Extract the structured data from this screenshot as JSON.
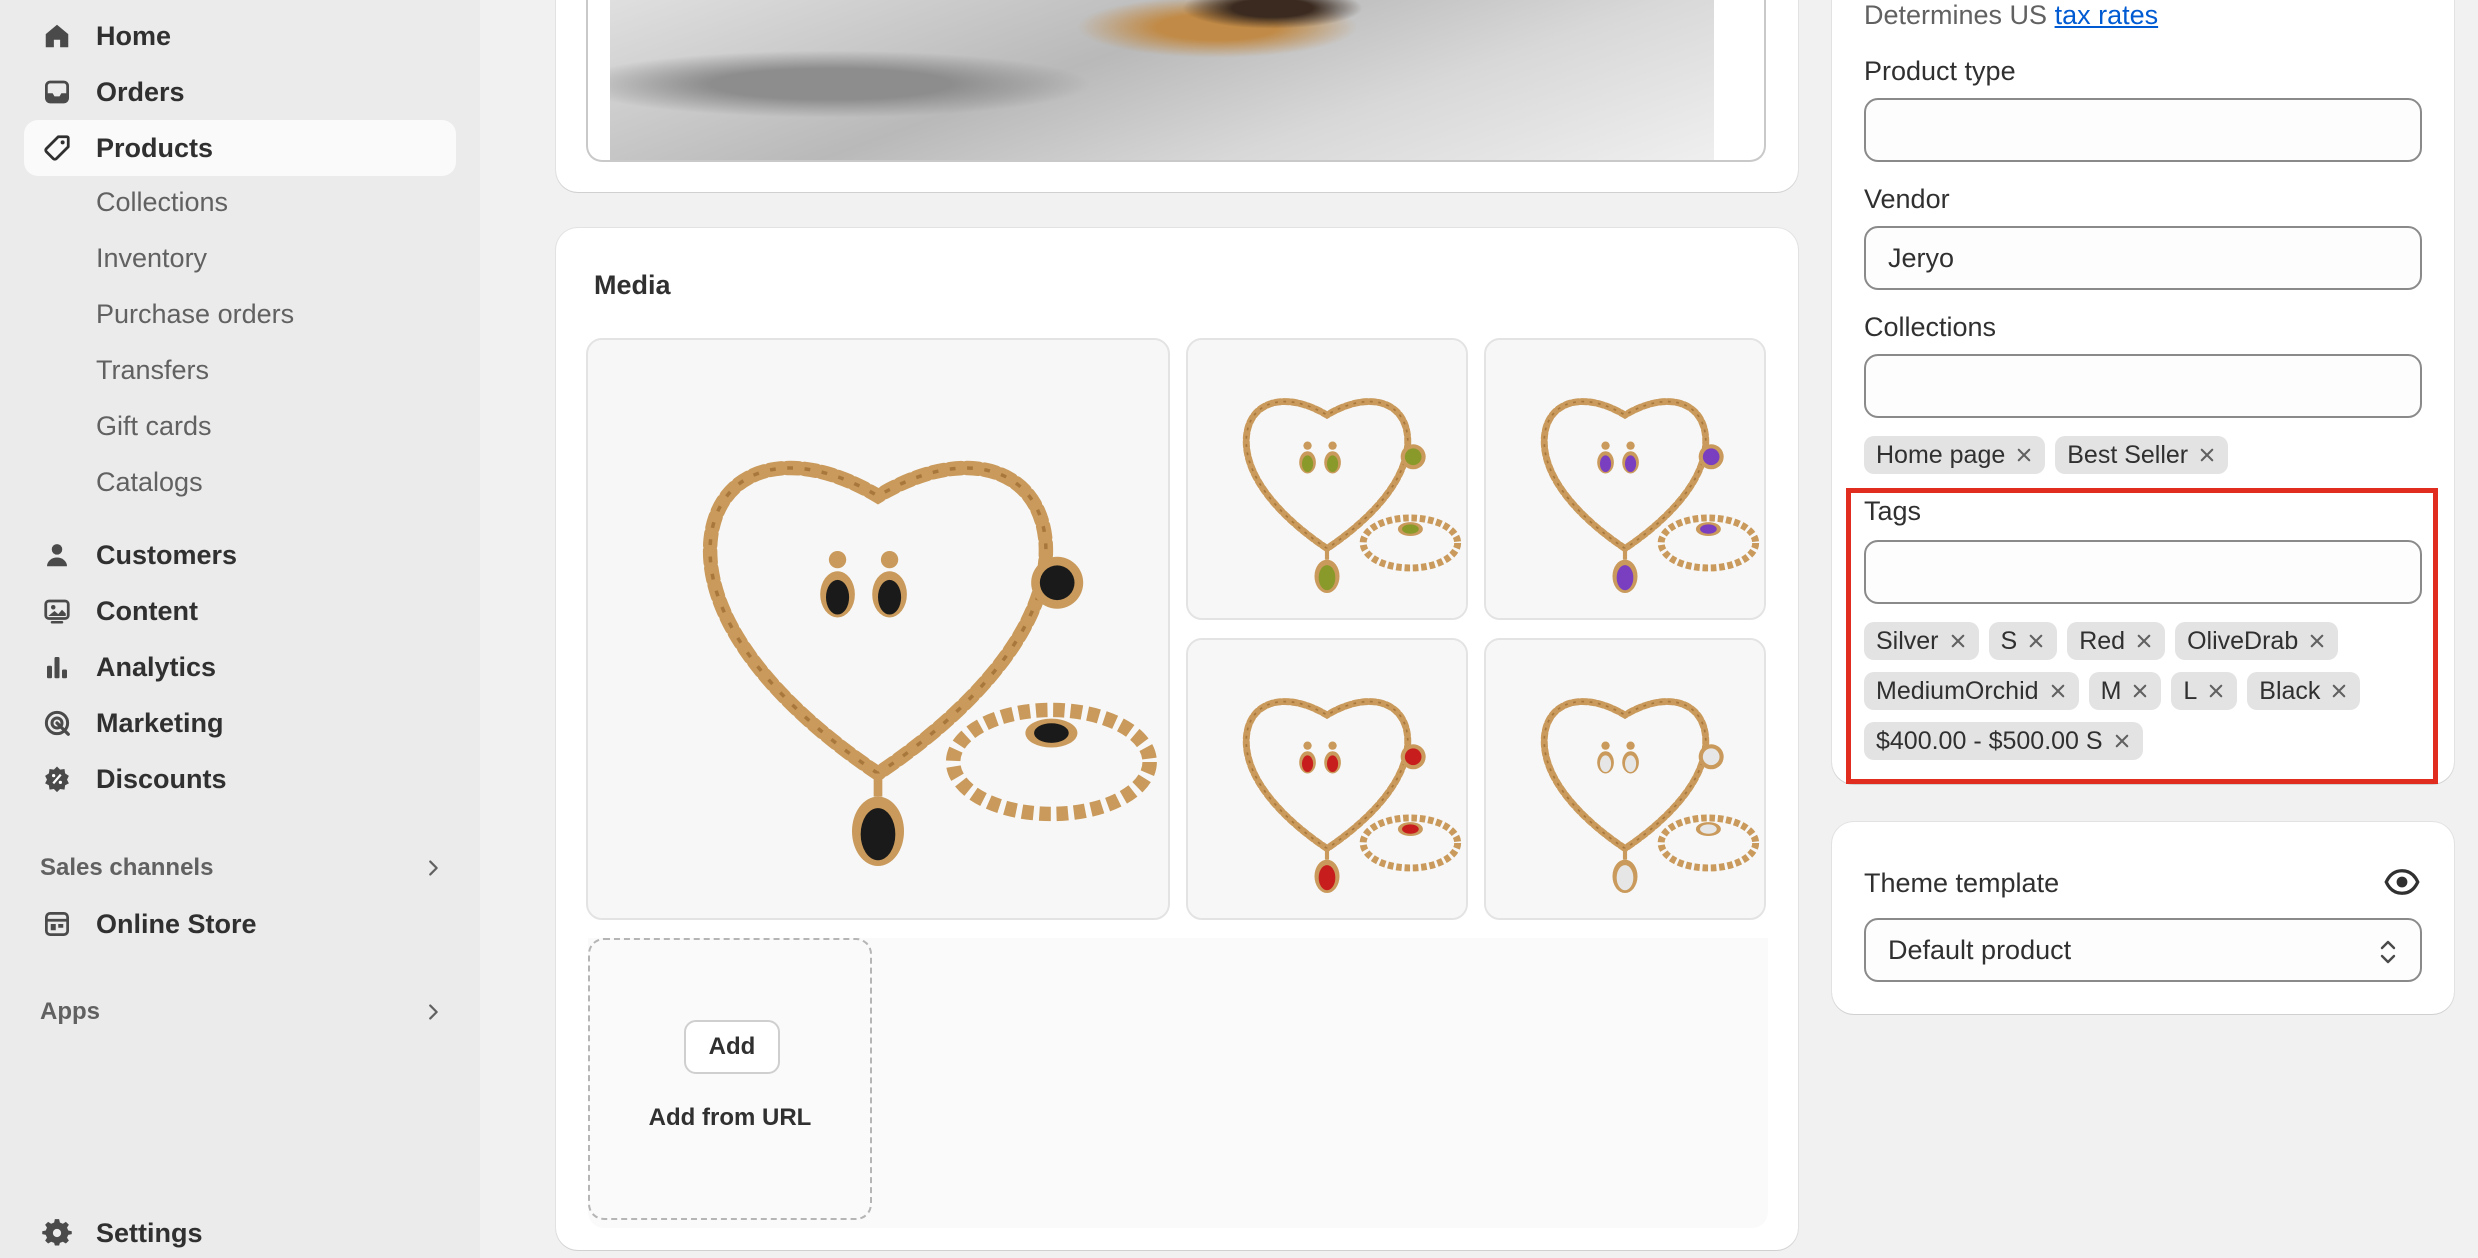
{
  "sidebar": {
    "items": [
      {
        "label": "Home",
        "icon": "home-icon"
      },
      {
        "label": "Orders",
        "icon": "inbox-icon"
      },
      {
        "label": "Products",
        "icon": "tag-icon",
        "active": true
      },
      {
        "label": "Customers",
        "icon": "person-icon"
      },
      {
        "label": "Content",
        "icon": "image-icon"
      },
      {
        "label": "Analytics",
        "icon": "bar-chart-icon"
      },
      {
        "label": "Marketing",
        "icon": "target-icon"
      },
      {
        "label": "Discounts",
        "icon": "discount-icon"
      },
      {
        "label": "Online Store",
        "icon": "store-icon"
      },
      {
        "label": "Settings",
        "icon": "gear-icon"
      }
    ],
    "product_subitems": [
      "Collections",
      "Inventory",
      "Purchase orders",
      "Transfers",
      "Gift cards",
      "Catalogs"
    ],
    "sales_channels_heading": "Sales channels",
    "apps_heading": "Apps"
  },
  "media": {
    "title": "Media",
    "add_label": "Add",
    "add_url_label": "Add from URL",
    "stone_colors": [
      "#1a1a1a",
      "#8a9a2a",
      "#7a3ec0",
      "#c81d1d",
      "#e6e6e6"
    ]
  },
  "organization": {
    "tax_note_prefix": "Determines US",
    "tax_link": "tax rates",
    "product_type_label": "Product type",
    "product_type_value": "",
    "vendor_label": "Vendor",
    "vendor_value": "Jeryo",
    "collections_label": "Collections",
    "collections_value": "",
    "collections_chips": [
      "Home page",
      "Best Seller"
    ],
    "tags_label": "Tags",
    "tags_value": "",
    "tags_chips": [
      "Silver",
      "S",
      "Red",
      "OliveDrab",
      "MediumOrchid",
      "M",
      "L",
      "Black",
      "$400.00 - $500.00 S"
    ]
  },
  "theme": {
    "label": "Theme template",
    "selected": "Default product"
  },
  "colors": {
    "highlight": "#e02d1f",
    "link": "#005bd3"
  }
}
